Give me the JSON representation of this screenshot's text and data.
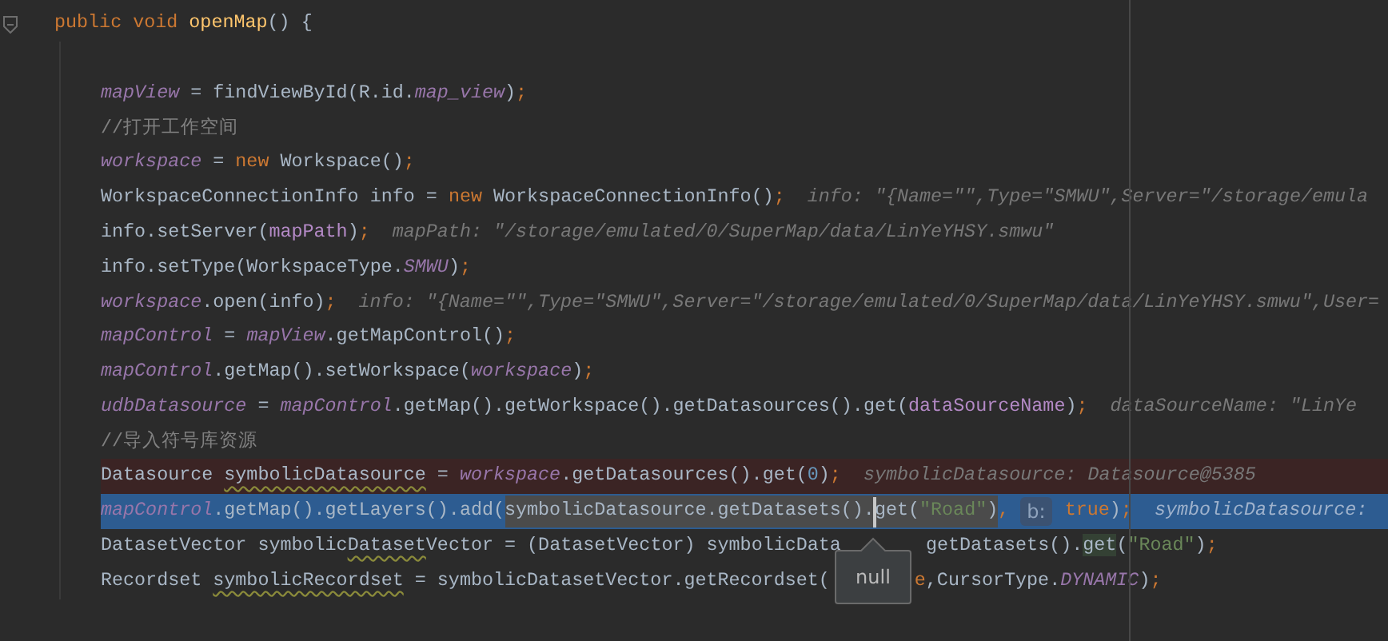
{
  "editor": {
    "lines": [
      {
        "segments": [
          {
            "kind": "code",
            "tokens": [
              {
                "kind": "keyword",
                "text": "public void "
              },
              {
                "kind": "method",
                "text": "openMap"
              },
              {
                "kind": "plain",
                "text": "() {"
              }
            ]
          }
        ],
        "folded": false,
        "children": [
          {
            "segments": [
              {
                "kind": "code",
                "tokens": [
                  {
                    "kind": "field",
                    "text": "mapView"
                  },
                  {
                    "kind": "plain",
                    "text": " = findViewById(R.id."
                  },
                  {
                    "kind": "field",
                    "text": "map_view"
                  },
                  {
                    "kind": "plain",
                    "text": ")"
                  },
                  {
                    "kind": "keyword",
                    "text": ";"
                  }
                ]
              }
            ]
          },
          {
            "segments": [
              {
                "kind": "code",
                "tokens": [
                  {
                    "kind": "comment",
                    "text": "//打开工作空间"
                  }
                ]
              }
            ]
          },
          {
            "segments": [
              {
                "kind": "code",
                "tokens": [
                  {
                    "kind": "field",
                    "text": "workspace"
                  },
                  {
                    "kind": "plain",
                    "text": " = "
                  },
                  {
                    "kind": "keyword",
                    "text": "new "
                  },
                  {
                    "kind": "plain",
                    "text": "Workspace()"
                  },
                  {
                    "kind": "keyword",
                    "text": ";"
                  }
                ]
              }
            ]
          },
          {
            "segments": [
              {
                "kind": "code",
                "tokens": [
                  {
                    "kind": "plain",
                    "text": "WorkspaceConnectionInfo info = "
                  },
                  {
                    "kind": "keyword",
                    "text": "new "
                  },
                  {
                    "kind": "plain",
                    "text": "WorkspaceConnectionInfo()"
                  },
                  {
                    "kind": "keyword",
                    "text": ";"
                  }
                ]
              },
              {
                "kind": "hint",
                "tokens": [
                  {
                    "kind": "hint",
                    "text": "info: \"{Name=\"\",Type=\"SMWU\",Server=\"/storage/emula"
                  }
                ]
              }
            ]
          },
          {
            "segments": [
              {
                "kind": "code",
                "tokens": [
                  {
                    "kind": "plain",
                    "text": "info.setServer("
                  },
                  {
                    "kind": "param",
                    "text": "mapPath"
                  },
                  {
                    "kind": "plain",
                    "text": ")"
                  },
                  {
                    "kind": "keyword",
                    "text": ";"
                  }
                ]
              },
              {
                "kind": "hint",
                "tokens": [
                  {
                    "kind": "hint",
                    "text": "mapPath: \"/storage/emulated/0/SuperMap/data/LinYeYHSY.smwu\""
                  }
                ]
              }
            ]
          },
          {
            "segments": [
              {
                "kind": "code",
                "tokens": [
                  {
                    "kind": "plain",
                    "text": "info.setType(WorkspaceType."
                  },
                  {
                    "kind": "field",
                    "text": "SMWU"
                  },
                  {
                    "kind": "plain",
                    "text": ")"
                  },
                  {
                    "kind": "keyword",
                    "text": ";"
                  }
                ]
              }
            ]
          },
          {
            "segments": [
              {
                "kind": "code",
                "tokens": [
                  {
                    "kind": "field",
                    "text": "workspace"
                  },
                  {
                    "kind": "plain",
                    "text": ".open(info)"
                  },
                  {
                    "kind": "keyword",
                    "text": ";"
                  }
                ]
              },
              {
                "kind": "hint",
                "tokens": [
                  {
                    "kind": "hint",
                    "text": "info: \"{Name=\"\",Type=\"SMWU\",Server=\"/storage/emulated/0/SuperMap/data/LinYeYHSY.smwu\",User="
                  }
                ]
              }
            ]
          },
          {
            "segments": [
              {
                "kind": "code",
                "tokens": [
                  {
                    "kind": "field",
                    "text": "mapControl"
                  },
                  {
                    "kind": "plain",
                    "text": " = "
                  },
                  {
                    "kind": "field",
                    "text": "mapView"
                  },
                  {
                    "kind": "plain",
                    "text": ".getMapControl()"
                  },
                  {
                    "kind": "keyword",
                    "text": ";"
                  }
                ]
              }
            ]
          },
          {
            "segments": [
              {
                "kind": "code",
                "tokens": [
                  {
                    "kind": "field",
                    "text": "mapControl"
                  },
                  {
                    "kind": "plain",
                    "text": ".getMap().setWorkspace("
                  },
                  {
                    "kind": "field",
                    "text": "workspace"
                  },
                  {
                    "kind": "plain",
                    "text": ")"
                  },
                  {
                    "kind": "keyword",
                    "text": ";"
                  }
                ]
              }
            ]
          },
          {
            "segments": [
              {
                "kind": "code",
                "tokens": [
                  {
                    "kind": "field",
                    "text": "udbDatasource"
                  },
                  {
                    "kind": "plain",
                    "text": " = "
                  },
                  {
                    "kind": "field",
                    "text": "mapControl"
                  },
                  {
                    "kind": "plain",
                    "text": ".getMap().getWorkspace().getDatasources().get("
                  },
                  {
                    "kind": "param",
                    "text": "dataSourceName"
                  },
                  {
                    "kind": "plain",
                    "text": ")"
                  },
                  {
                    "kind": "keyword",
                    "text": ";"
                  }
                ]
              },
              {
                "kind": "hint",
                "tokens": [
                  {
                    "kind": "hint",
                    "text": "dataSourceName: \"LinYe"
                  }
                ]
              }
            ]
          },
          {
            "segments": [
              {
                "kind": "code",
                "tokens": [
                  {
                    "kind": "comment",
                    "text": "//导入符号库资源"
                  }
                ]
              }
            ]
          },
          {
            "breakpoint": true,
            "segments": [
              {
                "kind": "code",
                "tokens": [
                  {
                    "kind": "plain",
                    "text": "Datasource "
                  },
                  {
                    "kind": "plain",
                    "text": "symbolicDatasource",
                    "warn": true
                  },
                  {
                    "kind": "plain",
                    "text": " = "
                  },
                  {
                    "kind": "field",
                    "text": "workspace"
                  },
                  {
                    "kind": "plain",
                    "text": ".getDatasources().get("
                  },
                  {
                    "kind": "number",
                    "text": "0"
                  },
                  {
                    "kind": "plain",
                    "text": ")"
                  },
                  {
                    "kind": "keyword",
                    "text": ";"
                  }
                ]
              },
              {
                "kind": "hint",
                "tokens": [
                  {
                    "kind": "hint",
                    "text": "symbolicDatasource: Datasource@5385"
                  }
                ]
              }
            ]
          },
          {
            "execution_point": true,
            "segments": [
              {
                "kind": "code",
                "tokens": [
                  {
                    "kind": "field",
                    "text": "mapControl"
                  },
                  {
                    "kind": "plain",
                    "text": ".getMap().getLayers().add("
                  }
                ]
              },
              {
                "kind": "evaluated",
                "tokens": [
                  {
                    "kind": "plain",
                    "text": "symbolicDatasource.getDatasets()."
                  }
                ]
              },
              {
                "kind": "caret"
              },
              {
                "kind": "evaluated",
                "tokens": [
                  {
                    "kind": "plain",
                    "text": "get("
                  },
                  {
                    "kind": "string",
                    "text": "\"Road\""
                  },
                  {
                    "kind": "plain",
                    "text": ")"
                  }
                ]
              },
              {
                "kind": "code",
                "tokens": [
                  {
                    "kind": "keyword",
                    "text": ", "
                  }
                ]
              },
              {
                "kind": "param-hint",
                "tokens": [
                  {
                    "kind": "plain",
                    "text": "b:"
                  }
                ]
              },
              {
                "kind": "code",
                "tokens": [
                  {
                    "kind": "keyword",
                    "text": " true"
                  },
                  {
                    "kind": "plain",
                    "text": ")"
                  },
                  {
                    "kind": "keyword",
                    "text": ";"
                  }
                ]
              },
              {
                "kind": "hint",
                "tokens": [
                  {
                    "kind": "hint",
                    "text": "symbolicDatasource:"
                  }
                ]
              }
            ]
          },
          {
            "segments": [
              {
                "kind": "code",
                "tokens": [
                  {
                    "kind": "plain",
                    "text": "DatasetVector symbolic"
                  },
                  {
                    "kind": "plain",
                    "text": "Dataset",
                    "warn": true
                  },
                  {
                    "kind": "plain",
                    "text": "Vector = (DatasetVector) symbolicData"
                  }
                ]
              },
              {
                "kind": "gap"
              },
              {
                "kind": "code",
                "tokens": [
                  {
                    "kind": "plain",
                    "text": "getDatasets()."
                  },
                  {
                    "kind": "plain",
                    "text": "get",
                    "usage": true
                  },
                  {
                    "kind": "plain",
                    "text": "("
                  },
                  {
                    "kind": "string",
                    "text": "\"Road\""
                  },
                  {
                    "kind": "plain",
                    "text": ")"
                  },
                  {
                    "kind": "keyword",
                    "text": ";"
                  }
                ]
              }
            ]
          },
          {
            "segments": [
              {
                "kind": "code",
                "tokens": [
                  {
                    "kind": "plain",
                    "text": "Recordset "
                  },
                  {
                    "kind": "plain",
                    "text": "symbolicRecordset",
                    "warn": true
                  },
                  {
                    "kind": "plain",
                    "text": " = symbolicDatasetVector.getRecordset("
                  }
                ]
              },
              {
                "kind": "gap"
              },
              {
                "kind": "code",
                "tokens": [
                  {
                    "kind": "keyword",
                    "text": "e"
                  },
                  {
                    "kind": "plain",
                    "text": ",CursorType."
                  },
                  {
                    "kind": "field",
                    "text": "DYNAMIC"
                  },
                  {
                    "kind": "plain",
                    "text": ")"
                  },
                  {
                    "kind": "keyword",
                    "text": ";"
                  }
                ]
              }
            ]
          }
        ]
      }
    ]
  },
  "tooltip": {
    "text": "null"
  }
}
